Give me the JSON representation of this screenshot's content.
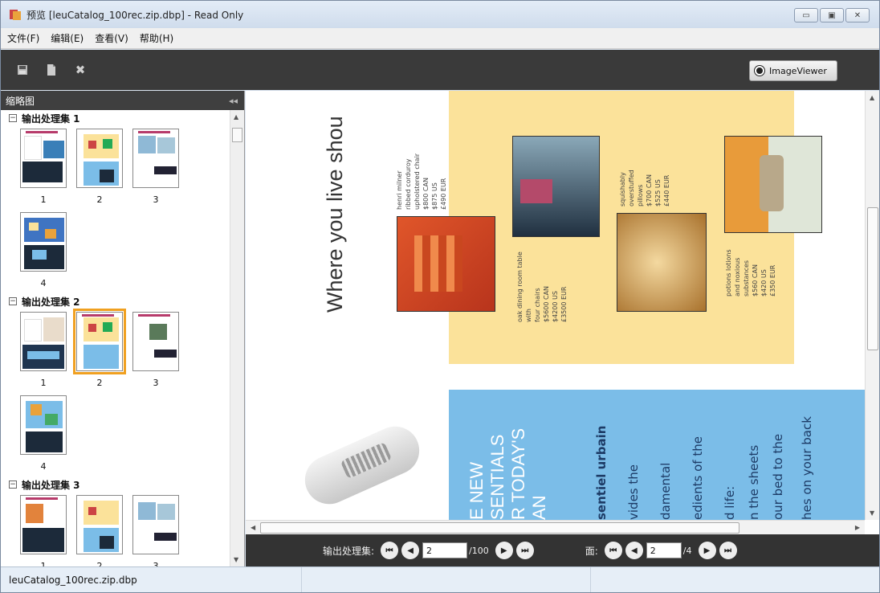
{
  "window": {
    "title": "预览 [leuCatalog_100rec.zip.dbp] - Read Only",
    "controls": {
      "minimize": "▭",
      "maximize": "▣",
      "close": "✕"
    }
  },
  "menu": [
    "文件(F)",
    "编辑(E)",
    "查看(V)",
    "帮助(H)"
  ],
  "toolbar": {
    "icons": [
      "save-icon",
      "document-icon",
      "close-icon"
    ],
    "image_viewer_label": "ImageViewer"
  },
  "sidebar": {
    "title": "缩略图",
    "collapse_glyph": "◂◂",
    "groups": [
      {
        "title": "输出处理集 1",
        "pages": [
          "1",
          "2",
          "3",
          "4"
        ]
      },
      {
        "title": "输出处理集 2",
        "pages": [
          "1",
          "2",
          "3",
          "4"
        ],
        "selected": "2"
      },
      {
        "title": "输出处理集 3",
        "pages": [
          "1",
          "2",
          "3"
        ]
      }
    ]
  },
  "preview": {
    "headline": "Where you live shou",
    "products": [
      "henri milner\nribbed corduroy\nupholstered chair\n$800 CAN\n$875 US\n£490 EUR",
      "oak dining room table\nwith\nfour chairs\n$5600 CAN\n$4200 US\n£3500 EUR",
      "squishably\noverstuffed\npillows\n$700 CAN\n$525 US\n£440 EUR",
      "potions lotions\nand noxious\nsubstances\n$560 CAN\n$420 US\n£350 EUR"
    ],
    "essentials_lines": [
      "E NEW",
      "SENTIALS",
      "R TODAY'S",
      "AN"
    ],
    "body_lines": [
      "sentiel urbain",
      "vides the",
      "damental",
      "edients of the",
      "d life:",
      "n the sheets",
      "our bed to the",
      "hes on your back"
    ]
  },
  "navigation": {
    "set_label": "输出处理集:",
    "set_current": "2",
    "set_total": "/100",
    "face_label": "面:",
    "face_current": "2",
    "face_total": "/4",
    "buttons": {
      "first": "⏮",
      "prev": "◀",
      "next": "▶",
      "last": "⏭"
    }
  },
  "status": {
    "filename": "leuCatalog_100rec.zip.dbp"
  },
  "colors": {
    "yellow": "#fbe29a",
    "blue": "#7bbde8",
    "selected_outline": "#f0a020"
  }
}
